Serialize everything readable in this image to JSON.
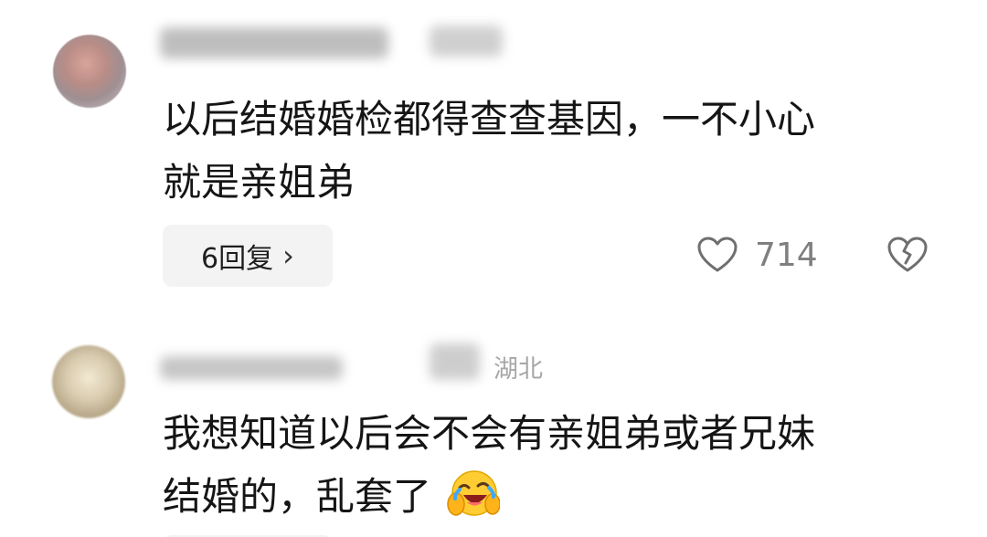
{
  "comments": [
    {
      "text_line1": "以后结婚婚检都得查查基因，一不小心",
      "text_line2": "就是亲姐弟",
      "reply_label": "6回复",
      "likes": "714"
    },
    {
      "location": "湖北",
      "text_line1": "我想知道以后会不会有亲姐弟或者兄妹",
      "text_line2": "结婚的，乱套了",
      "emoji": "laughing-crying-face-icon"
    }
  ]
}
